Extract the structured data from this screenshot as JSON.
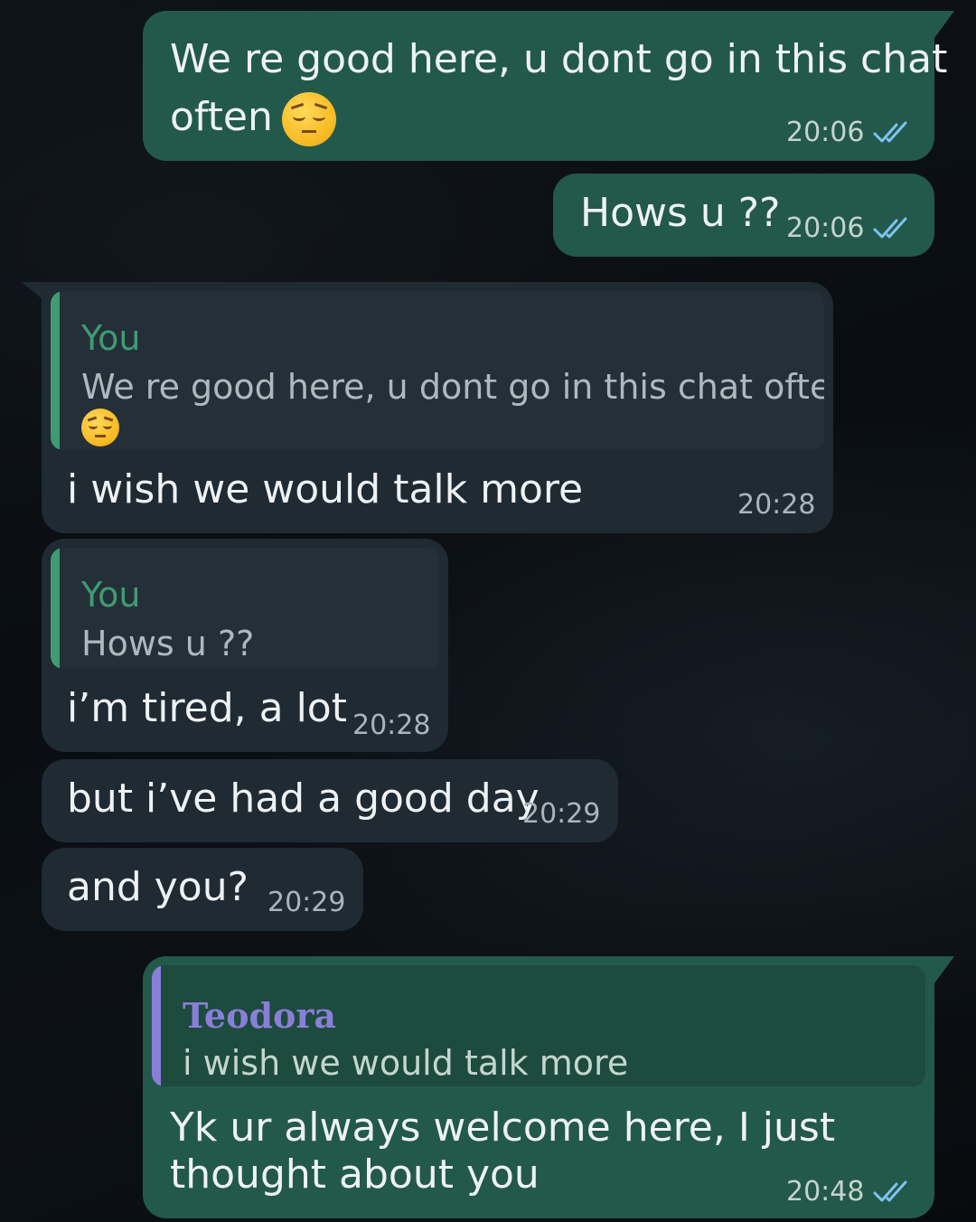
{
  "colors": {
    "outgoing_bubble": "#23594a",
    "incoming_bubble": "#1f2a33",
    "read_ticks": "#7fc3f0",
    "quote_you": "#3f9b72",
    "quote_teodora": "#8a7fd8"
  },
  "messages": [
    {
      "id": "m1",
      "direction": "outgoing",
      "text_line1": "We re good here, u dont go in this chat",
      "text_line2": "often",
      "emoji": "pensive-face",
      "time": "20:06",
      "status": "read"
    },
    {
      "id": "m2",
      "direction": "outgoing",
      "text": "Hows u ??",
      "time": "20:06",
      "status": "read"
    },
    {
      "id": "m3",
      "direction": "incoming",
      "quote_author": "You",
      "quote_text": "We re good here, u dont go in this chat often",
      "quote_emoji": "pensive-face",
      "text": "i wish we would talk more",
      "time": "20:28"
    },
    {
      "id": "m4",
      "direction": "incoming",
      "quote_author": "You",
      "quote_text": "Hows u ??",
      "text": "i’m tired, a lot",
      "time": "20:28"
    },
    {
      "id": "m5",
      "direction": "incoming",
      "text": "but i’ve had a good day",
      "time": "20:29"
    },
    {
      "id": "m6",
      "direction": "incoming",
      "text": "and you?",
      "time": "20:29"
    },
    {
      "id": "m7",
      "direction": "outgoing",
      "quote_author": "Teodora",
      "quote_text": "i wish we would talk more",
      "text_line1": "Yk ur always welcome here, I just",
      "text_line2": "thought about you",
      "time": "20:48",
      "status": "read"
    }
  ]
}
